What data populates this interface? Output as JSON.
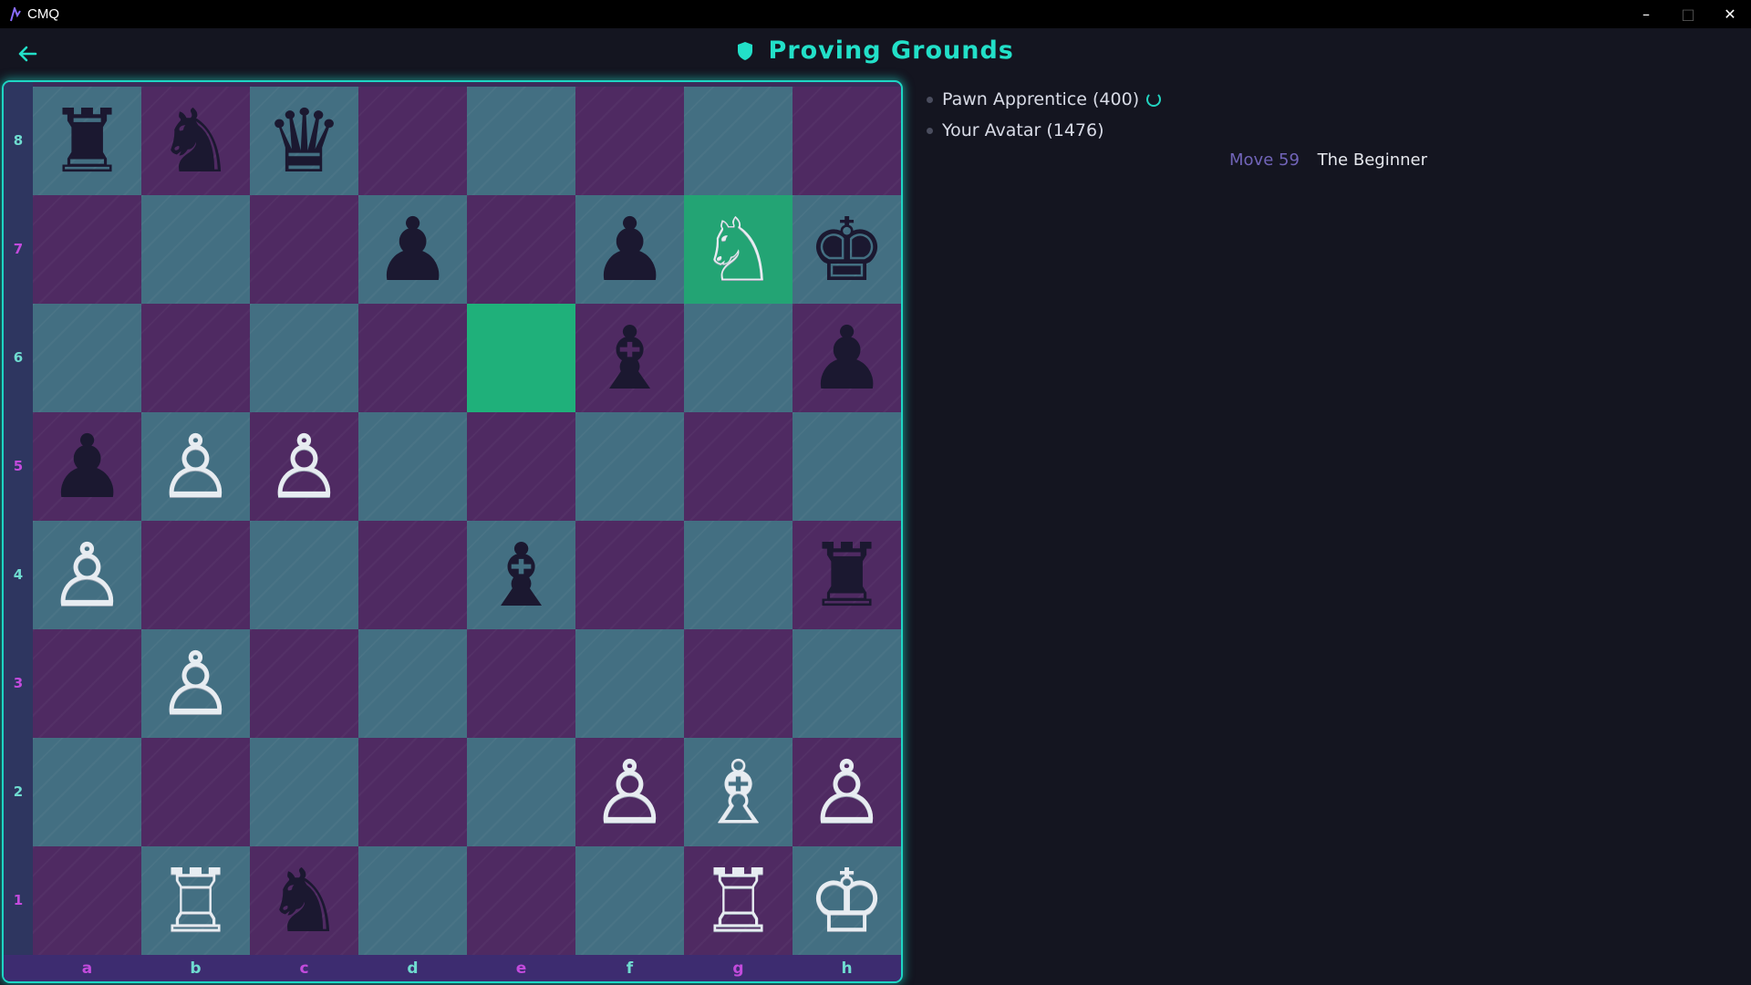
{
  "window": {
    "title": "CMQ",
    "controls": {
      "minimize": "–",
      "maximize": "□",
      "close": "✕"
    }
  },
  "header": {
    "title": "Proving Grounds",
    "back_icon": "arrow-left-icon",
    "title_icon": "shield-icon"
  },
  "colors": {
    "accent": "#22e0c8",
    "light_square": "#436f82",
    "dark_square": "#4f2a62",
    "highlight": "#23a474",
    "rank_label_colors": [
      "#6fdcd0",
      "#c24bdc"
    ]
  },
  "board": {
    "files": [
      "a",
      "b",
      "c",
      "d",
      "e",
      "f",
      "g",
      "h"
    ],
    "ranks": [
      "8",
      "7",
      "6",
      "5",
      "4",
      "3",
      "2",
      "1"
    ],
    "highlighted": [
      "e6",
      "g7"
    ],
    "pieces": {
      "a8": "♜",
      "b8": "♞",
      "c8": "♛",
      "d7": "♟",
      "f7": "♟",
      "g7": "♘",
      "h7": "♚",
      "f6": "♝",
      "h6": "♟",
      "a5": "♟",
      "b5": "♙",
      "c5": "♙",
      "a4": "♙",
      "e4": "♝",
      "h4": "♜",
      "b3": "♙",
      "f2": "♙",
      "g2": "♗",
      "h2": "♙",
      "b1": "♖",
      "c1": "♞",
      "g1": "♖",
      "h1": "♔"
    }
  },
  "players": [
    {
      "label": "Pawn Apprentice (400)",
      "thinking": true
    },
    {
      "label": "Your Avatar (1476)",
      "thinking": false
    }
  ],
  "move_info": {
    "move_label": "Move 59",
    "opening": "The Beginner"
  }
}
